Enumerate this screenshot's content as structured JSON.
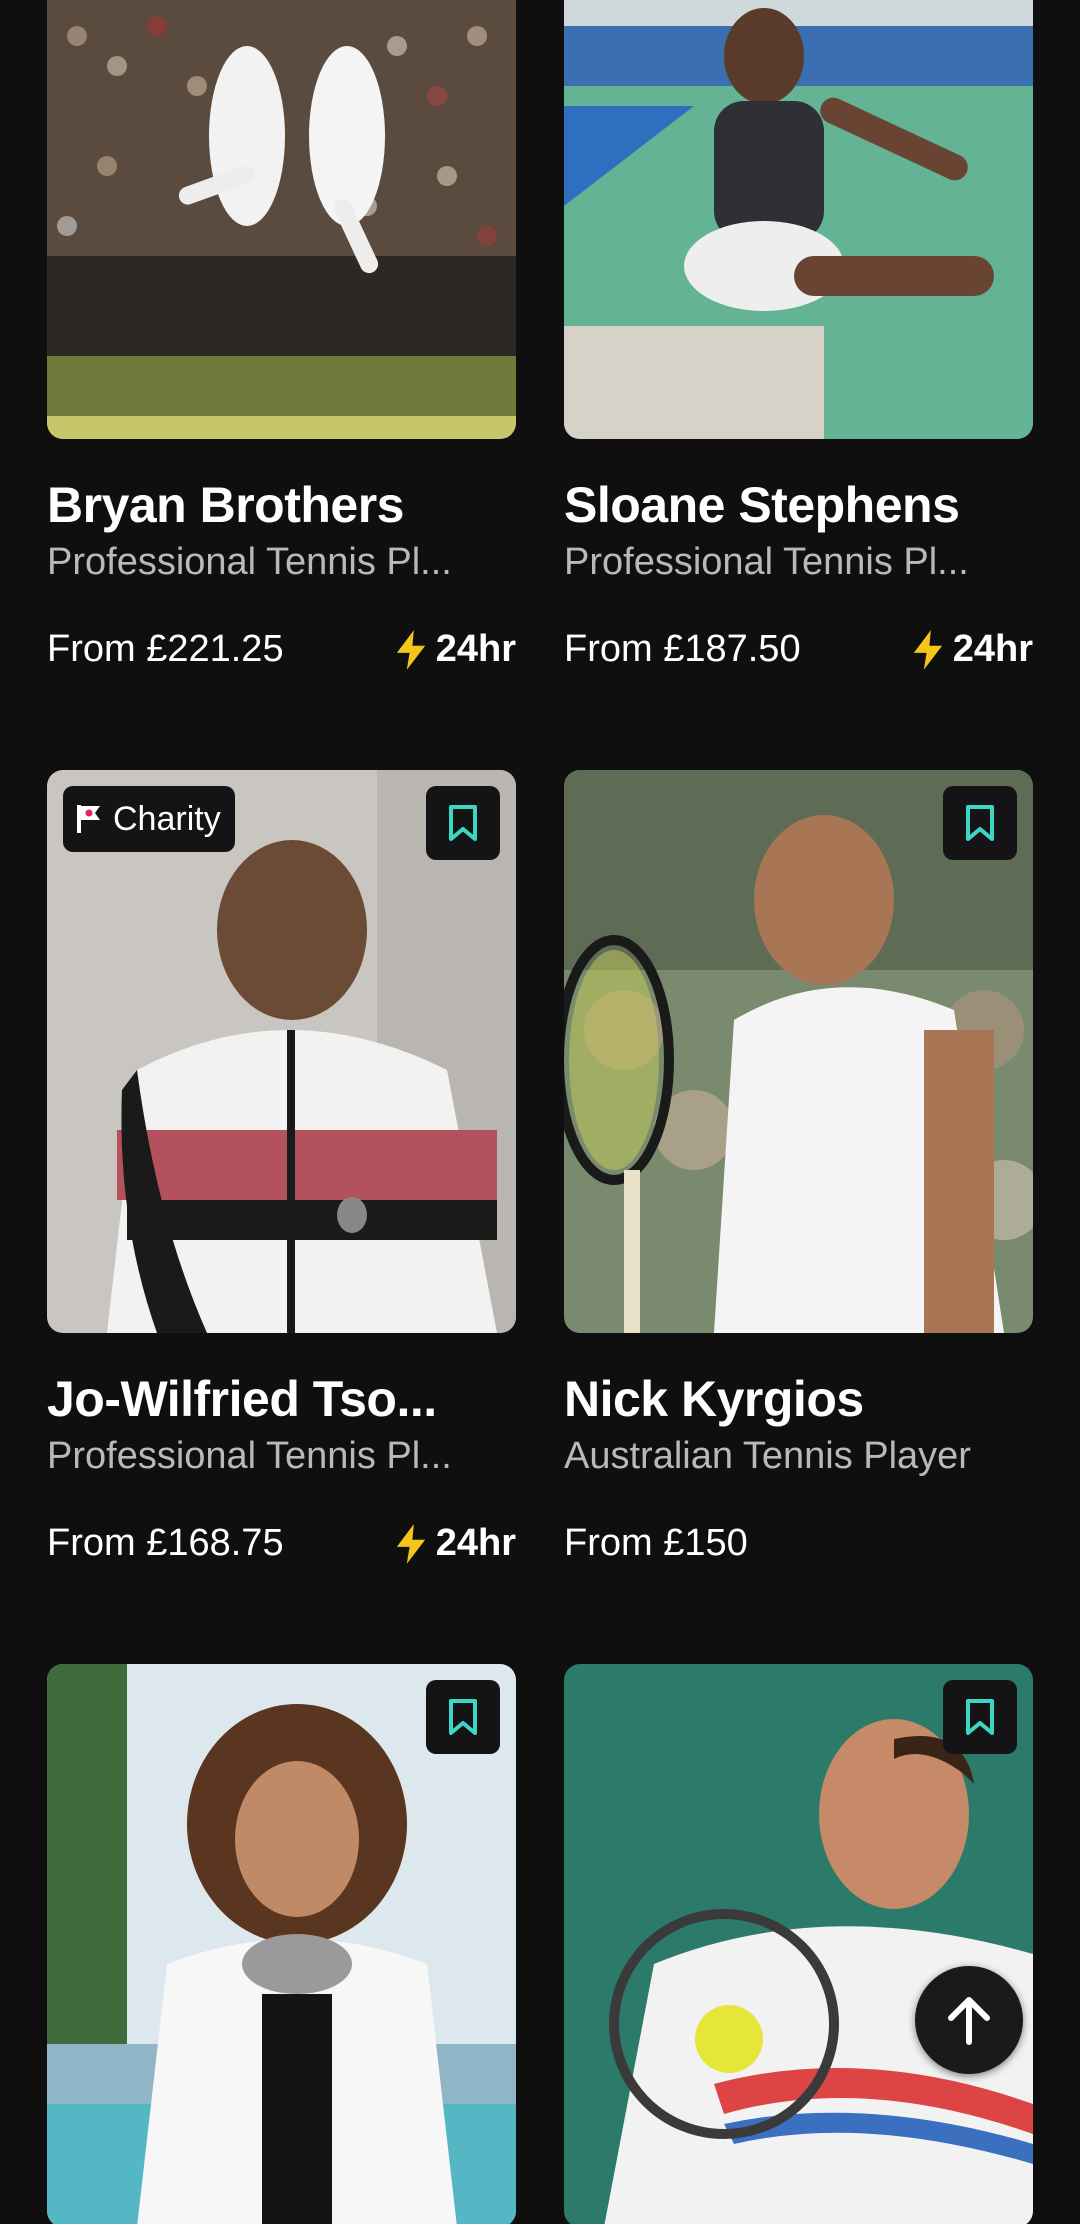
{
  "colors": {
    "background": "#0f0f10",
    "accent_bolt": "#f5c518",
    "bookmark_icon": "#3dd6c4",
    "subtitle": "#b9b9bd"
  },
  "cards": [
    {
      "name": "Bryan Brothers",
      "subtitle": "Professional Tennis Pl...",
      "price_prefix": "From",
      "price": "£221.25",
      "speed": "24hr",
      "image_icon": "tennis-doubles-photo"
    },
    {
      "name": "Sloane Stephens",
      "subtitle": "Professional Tennis Pl...",
      "price_prefix": "From",
      "price": "£187.50",
      "speed": "24hr",
      "image_icon": "tennis-player-photo"
    },
    {
      "name": "Jo-Wilfried Tso...",
      "subtitle": "Professional Tennis Pl...",
      "price_prefix": "From",
      "price": "£168.75",
      "speed": "24hr",
      "badge": "Charity",
      "image_icon": "tennis-player-photo"
    },
    {
      "name": "Nick Kyrgios",
      "subtitle": "Australian Tennis Player",
      "price_prefix": "From",
      "price": "£150",
      "image_icon": "tennis-player-photo"
    },
    {
      "image_icon": "presenter-photo"
    },
    {
      "image_icon": "tennis-player-photo"
    }
  ]
}
